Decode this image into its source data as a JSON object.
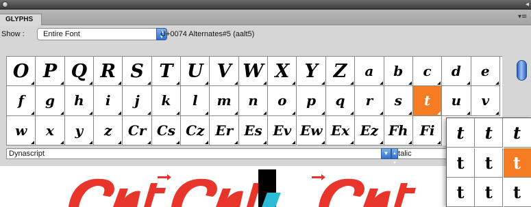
{
  "panel": {
    "tab_label": "GLYPHS",
    "collapse_icon": "double-chevron-right-icon",
    "menu_icon": "panel-menu-icon"
  },
  "toolbar": {
    "show_label": "Show :",
    "show_value": "Entire Font",
    "unicode_info": "U+0074 Alternates#5 (aalt5)"
  },
  "glyph_rows": [
    [
      "O",
      "P",
      "Q",
      "R",
      "S",
      "T",
      "U",
      "V",
      "W",
      "X",
      "Y",
      "Z",
      "a",
      "b",
      "c",
      "d",
      "e"
    ],
    [
      "f",
      "g",
      "h",
      "i",
      "j",
      "k",
      "l",
      "m",
      "n",
      "o",
      "p",
      "q",
      "r",
      "s",
      "t",
      "u",
      "v"
    ],
    [
      "w",
      "x",
      "y",
      "z",
      "Cr",
      "Cs",
      "Cz",
      "Er",
      "Es",
      "Ev",
      "Ew",
      "Ex",
      "Ez",
      "Fh",
      "Fi"
    ]
  ],
  "selected_glyph": "t",
  "font": {
    "family": "Dynascript",
    "style": "Italic"
  },
  "alternates": [
    [
      "t",
      "t",
      "t"
    ],
    [
      "t",
      "t",
      "t"
    ],
    [
      "t",
      "t",
      "t"
    ]
  ],
  "colors": {
    "selection": "#f57c23",
    "canvas_text": "#e8352b",
    "cursor_accent": "#29bcd4"
  }
}
